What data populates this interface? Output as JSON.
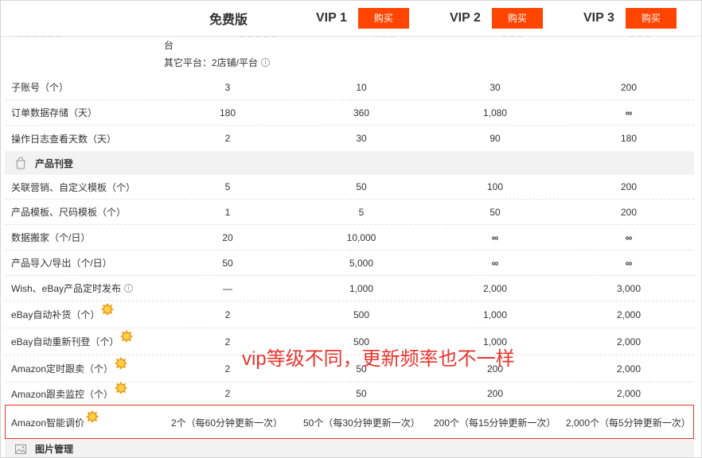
{
  "header": {
    "buy_label": "购买",
    "plans": [
      "免费版",
      "VIP 1",
      "VIP 2",
      "VIP 3"
    ]
  },
  "continuation": {
    "line1": "台",
    "line2": "其它平台：2店铺/平台"
  },
  "rows_group1": [
    {
      "label": "子账号（个）",
      "values": [
        "3",
        "10",
        "30",
        "200"
      ]
    },
    {
      "label": "订单数据存储（天）",
      "values": [
        "180",
        "360",
        "1,080",
        "∞"
      ]
    },
    {
      "label": "操作日志查看天数（天）",
      "values": [
        "2",
        "30",
        "90",
        "180"
      ]
    }
  ],
  "section_listing": {
    "title": "产品刊登",
    "icon": "shopping-bag-icon"
  },
  "rows_group2": [
    {
      "label": "关联营销、自定义模板（个）",
      "values": [
        "5",
        "50",
        "100",
        "200"
      ]
    },
    {
      "label": "产品模板、尺码模板（个）",
      "values": [
        "1",
        "5",
        "50",
        "200"
      ]
    },
    {
      "label": "数据搬家（个/日）",
      "values": [
        "20",
        "10,000",
        "∞",
        "∞"
      ]
    },
    {
      "label": "产品导入/导出（个/日）",
      "values": [
        "50",
        "5,000",
        "∞",
        "∞"
      ]
    },
    {
      "label": "Wish、eBay产品定时发布",
      "values": [
        "—",
        "1,000",
        "2,000",
        "3,000"
      ]
    },
    {
      "label": "eBay自动补货（个）",
      "values": [
        "2",
        "500",
        "1,000",
        "2,000"
      ]
    },
    {
      "label": "eBay自动重新刊登（个）",
      "values": [
        "2",
        "500",
        "1,000",
        "2,000"
      ]
    },
    {
      "label": "Amazon定时跟卖（个）",
      "values": [
        "2",
        "50",
        "200",
        "2,000"
      ]
    },
    {
      "label": "Amazon跟卖监控（个）",
      "values": [
        "2",
        "50",
        "200",
        "2,000"
      ]
    }
  ],
  "amazon_pricing": {
    "label": "Amazon智能调价",
    "values": [
      "2个（每60分钟更新一次）",
      "50个（每30分钟更新一次）",
      "200个（每15分钟更新一次）",
      "2,000个（每5分钟更新一次）"
    ]
  },
  "section_images": {
    "title": "图片管理",
    "icon": "image-icon"
  },
  "annotation": "vip等级不同，更新频率也不一样",
  "colors": {
    "buy_button": "#ff4500",
    "infinity": "#6cc04a",
    "annotation": "#e8342d",
    "section_bg": "#f2f2f2"
  }
}
